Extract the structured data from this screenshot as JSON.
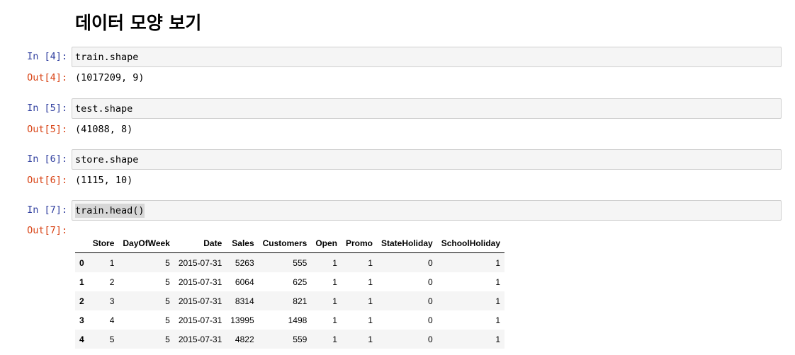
{
  "heading": "데이터 모양 보기",
  "cells": [
    {
      "in_prompt": "In [4]:",
      "code": "train.shape",
      "out_prompt": "Out[4]:",
      "output": "(1017209, 9)"
    },
    {
      "in_prompt": "In [5]:",
      "code": "test.shape",
      "out_prompt": "Out[5]:",
      "output": "(41088, 8)"
    },
    {
      "in_prompt": "In [6]:",
      "code": "store.shape",
      "out_prompt": "Out[6]:",
      "output": "(1115, 10)"
    },
    {
      "in_prompt": "In [7]:",
      "code": "train.head()",
      "out_prompt": "Out[7]:"
    }
  ],
  "table": {
    "columns": [
      "",
      "Store",
      "DayOfWeek",
      "Date",
      "Sales",
      "Customers",
      "Open",
      "Promo",
      "StateHoliday",
      "SchoolHoliday"
    ],
    "rows": [
      [
        "0",
        "1",
        "5",
        "2015-07-31",
        "5263",
        "555",
        "1",
        "1",
        "0",
        "1"
      ],
      [
        "1",
        "2",
        "5",
        "2015-07-31",
        "6064",
        "625",
        "1",
        "1",
        "0",
        "1"
      ],
      [
        "2",
        "3",
        "5",
        "2015-07-31",
        "8314",
        "821",
        "1",
        "1",
        "0",
        "1"
      ],
      [
        "3",
        "4",
        "5",
        "2015-07-31",
        "13995",
        "1498",
        "1",
        "1",
        "0",
        "1"
      ],
      [
        "4",
        "5",
        "5",
        "2015-07-31",
        "4822",
        "559",
        "1",
        "1",
        "0",
        "1"
      ]
    ]
  }
}
